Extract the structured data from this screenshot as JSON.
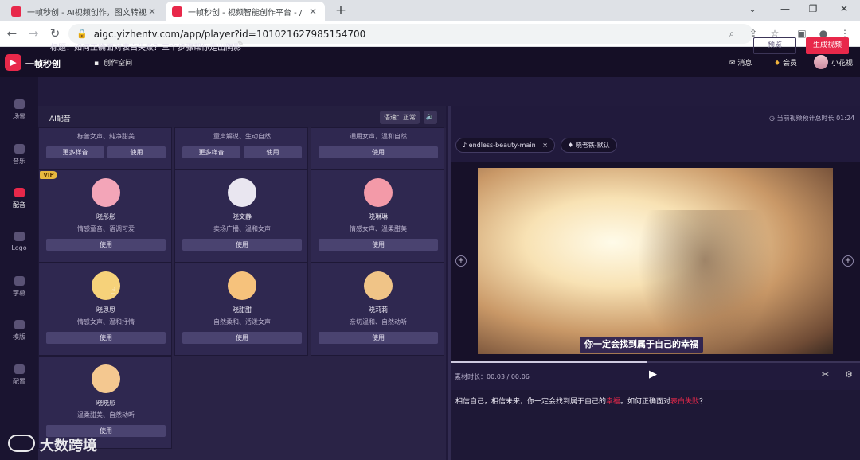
{
  "browser": {
    "tabs": [
      {
        "title": "一帧秒创 - AI视频创作，图文转视",
        "active": false
      },
      {
        "title": "一帧秒创 - 视频智能创作平台 - /",
        "active": true
      }
    ],
    "url": "aigc.yizhentv.com/app/player?id=101021627985154700"
  },
  "app": {
    "brand": "一帧秒创",
    "workspace": "创作空间",
    "top_right": {
      "messages": "消息",
      "member": "会员",
      "username": "小花视"
    },
    "rail": [
      {
        "label": "场景",
        "icon": "scene-icon",
        "active": false
      },
      {
        "label": "音乐",
        "icon": "music-icon",
        "active": false
      },
      {
        "label": "配音",
        "icon": "voice-icon",
        "active": true
      },
      {
        "label": "Logo",
        "icon": "logo-icon",
        "active": false
      },
      {
        "label": "字幕",
        "icon": "caption-icon",
        "active": false
      },
      {
        "label": "模版",
        "icon": "template-icon",
        "active": false
      },
      {
        "label": "配置",
        "icon": "config-icon",
        "active": false
      }
    ],
    "title": "标题：如何正确面对表白失败？三个步骤帮你走出阴影",
    "preview_button": "预览",
    "generate_button": "生成视频",
    "voice_panel": {
      "title": "AI配音",
      "speed": "语速：正常",
      "top_row": [
        {
          "desc": "标普女声、纯净甜美",
          "more": "更多样音",
          "use": "使用"
        },
        {
          "desc": "童声解说、生动自然",
          "more": "更多样音",
          "use": "使用"
        },
        {
          "desc": "通用女声，温和自然",
          "use": "使用"
        }
      ],
      "voices": [
        {
          "name": "晓彤彤",
          "desc": "情感童音、语调可爱",
          "use": "使用",
          "vip": "VIP",
          "avatar_color": "#f3a5b8"
        },
        {
          "name": "晓文静",
          "desc": "卖场广播、温和女声",
          "use": "使用",
          "avatar_color": "#e9e6f0"
        },
        {
          "name": "晓琳琳",
          "desc": "情感女声、温柔甜美",
          "use": "使用",
          "avatar_color": "#f39aa8"
        },
        {
          "name": "晓思思",
          "desc": "情感女声、温和抒情",
          "use": "使用",
          "avatar_color": "#f6d27a"
        },
        {
          "name": "晓甜甜",
          "desc": "自然柔和、活泼女声",
          "use": "使用",
          "avatar_color": "#f6c27c"
        },
        {
          "name": "晓莉莉",
          "desc": "亲切温和、自然动听",
          "use": "使用",
          "avatar_color": "#f0c487"
        },
        {
          "name": "晓晓彤",
          "desc": "温柔甜美、自然动听",
          "use": "使用",
          "avatar_color": "#f4c890"
        }
      ]
    },
    "preview": {
      "estimate": "当前视频预计总时长 01:24",
      "music_chip": "endless-beauty-main",
      "voice_chip": "晓老铁-默认",
      "subtitle": "你一定会找到属于自己的幸福",
      "progress": 0.48,
      "duration": "素材时长：00:03 / 00:06",
      "script_before": "相信自己，相信未来，你一定会找到属于自己的",
      "script_hl1": "幸福",
      "script_mid": "。如何正确面对",
      "script_hl2": "表白失败",
      "script_end": "？"
    },
    "watermark": "大数跨境"
  }
}
